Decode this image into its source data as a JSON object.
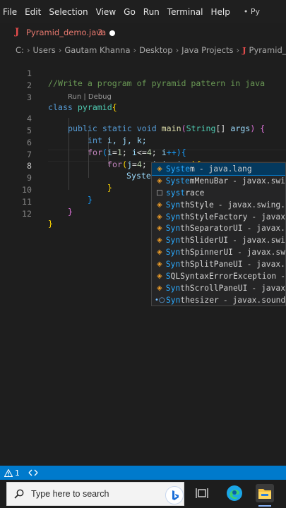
{
  "menubar": {
    "items": [
      "File",
      "Edit",
      "Selection",
      "View",
      "Go",
      "Run",
      "Terminal",
      "Help"
    ],
    "title": "• Py"
  },
  "tab": {
    "label": "Pyramid_demo.java",
    "problems": "3",
    "icon": "java-icon"
  },
  "breadcrumb": {
    "drive": "C:",
    "parts": [
      "Users",
      "Gautam Khanna",
      "Desktop",
      "Java Projects"
    ],
    "file": "Pyramid_dem"
  },
  "editor": {
    "line_numbers": [
      "1",
      "2",
      "3",
      "4",
      "5",
      "6",
      "7",
      "8",
      "9",
      "10",
      "11",
      "12"
    ],
    "active_line": "8",
    "codelens": "Run | Debug",
    "lines": {
      "l1_comment": "//Write a program of pyramid pattern in java",
      "l3_class": "class",
      "l3_name": "pyramid",
      "l3_brace": "{",
      "l4_public": "public",
      "l4_static": "static",
      "l4_void": "void",
      "l4_main": "main",
      "l4_paren": "(",
      "l4_string": "String",
      "l4_arr": "[] ",
      "l4_args": "args",
      "l4_close": ") {",
      "l5_int": "int",
      "l5_vars": " i, j, k;",
      "l6_for": "for",
      "l6_a": "(",
      "l6_i": "i",
      "l6_b": "=",
      "l6_n1": "1",
      "l6_c": "; ",
      "l6_i2": "i",
      "l6_d": "<=",
      "l6_n4": "4",
      "l6_e": "; ",
      "l6_i3": "i",
      "l6_f": "++)",
      "l6_brace": "{",
      "l7_for": "for",
      "l7_a": "(",
      "l7_j": "j",
      "l7_b": "=",
      "l7_n4": "4",
      "l7_c": "; ",
      "l7_j2": "j",
      "l7_d": ">",
      "l7_i": "i",
      "l7_e": "; ",
      "l7_j3": "j",
      "l7_f": "--)",
      "l7_brace": "{",
      "l8_typed": "Syste",
      "l9_brace": "}",
      "l10_brace": "}",
      "l11_brace": "}",
      "l12_brace": "}"
    }
  },
  "suggestions": [
    {
      "match": "Syste",
      "rest": "m",
      "detail": " - java.lang",
      "icon": "class-icon",
      "selected": true
    },
    {
      "match": "Syste",
      "rest": "mMenuBar",
      "detail": " - javax.swi",
      "icon": "class-icon"
    },
    {
      "match": "syst",
      "rest": "race",
      "detail": "",
      "icon": "snippet-icon"
    },
    {
      "match": "Syn",
      "rest": "thStyle",
      "detail": " - javax.swing.",
      "icon": "class-icon"
    },
    {
      "match": "Syn",
      "rest": "thStyleFactory",
      "detail": " - javax",
      "icon": "class-icon"
    },
    {
      "match": "Syn",
      "rest": "thSeparatorUI",
      "detail": " - javax.",
      "icon": "class-icon"
    },
    {
      "match": "Syn",
      "rest": "thSliderUI",
      "detail": " - javax.swi",
      "icon": "class-icon"
    },
    {
      "match": "Syn",
      "rest": "thSpinnerUI",
      "detail": " - javax.sw",
      "icon": "class-icon"
    },
    {
      "match": "Syn",
      "rest": "thSplitPaneUI",
      "detail": " - javax.",
      "icon": "class-icon"
    },
    {
      "match": "S",
      "rest": "QLSyntaxErrorException",
      "detail": " -",
      "icon": "class-icon"
    },
    {
      "match": "Syn",
      "rest": "thScrollPaneUI",
      "detail": " - javax",
      "icon": "class-icon"
    },
    {
      "match": "Syn",
      "rest": "thesizer",
      "detail": " - javax.sound.",
      "icon": "interface-icon"
    }
  ],
  "statusbar": {
    "warnings": "1",
    "warning_icon": "warning-icon",
    "remote_icon": "remote-icon"
  },
  "taskbar": {
    "search_placeholder": "Type here to search"
  },
  "colors": {
    "accent": "#007acc",
    "error": "#e24b4b",
    "selection": "#04395e"
  }
}
